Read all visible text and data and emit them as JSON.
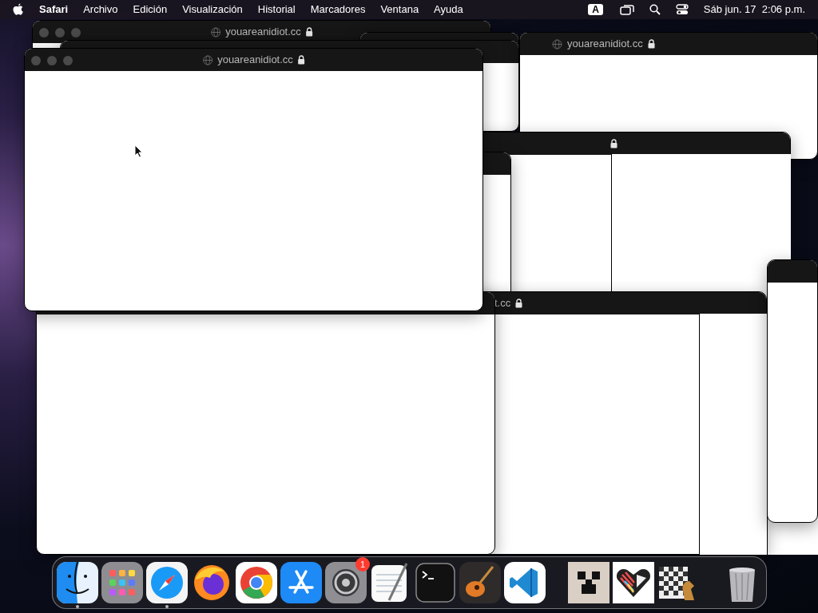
{
  "menu_bar": {
    "app": "Safari",
    "items": [
      "Archivo",
      "Edición",
      "Visualización",
      "Historial",
      "Marcadores",
      "Ventana",
      "Ayuda"
    ],
    "input_source": "A",
    "clock": "Sáb jun. 17  2:06 p.m."
  },
  "windows": [
    {
      "title": "youareanidiot.cc",
      "lock": true,
      "traffic_lights": true
    },
    {
      "title": "youareanidiot.cc",
      "lock": true,
      "traffic_lights": false
    },
    {
      "lock": true
    },
    {
      "title": "t.cc",
      "lock": true
    },
    {
      "title": "youareanidiot.cc",
      "lock": true,
      "traffic_lights": true
    }
  ],
  "dock": {
    "apps": [
      {
        "kind": "finder",
        "running": true
      },
      {
        "kind": "launchpad",
        "running": false
      },
      {
        "kind": "safari",
        "running": true
      },
      {
        "kind": "firefox",
        "running": false
      },
      {
        "kind": "chrome",
        "running": false
      },
      {
        "kind": "appstore",
        "running": false
      },
      {
        "kind": "settings",
        "running": false,
        "badge": "1"
      },
      {
        "kind": "textedit",
        "running": false
      },
      {
        "kind": "terminal",
        "running": false
      },
      {
        "kind": "garageband",
        "running": false
      },
      {
        "kind": "vscode",
        "running": false
      },
      {
        "kind": "divider"
      },
      {
        "kind": "creeper",
        "running": false
      },
      {
        "kind": "heart",
        "running": false
      },
      {
        "kind": "chess",
        "running": false
      },
      {
        "kind": "divider"
      },
      {
        "kind": "trash",
        "running": false
      }
    ]
  }
}
